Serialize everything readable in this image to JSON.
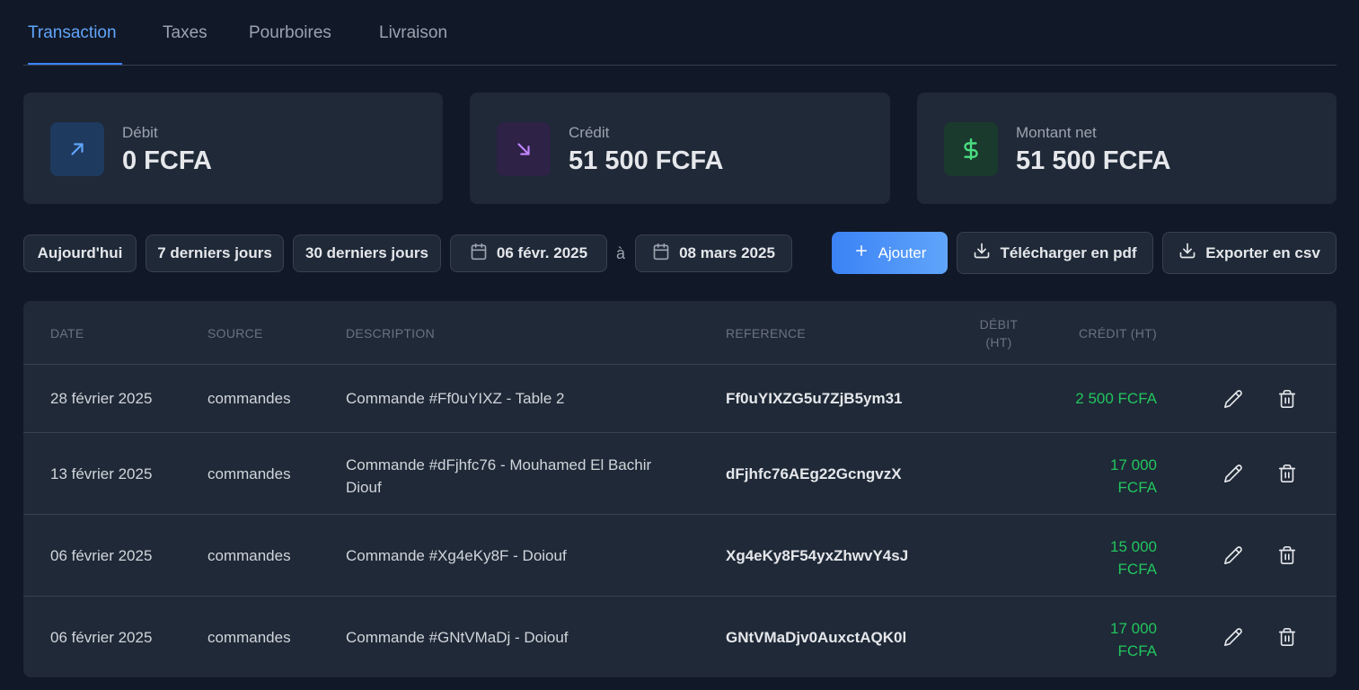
{
  "tabs": [
    "Transaction",
    "Taxes",
    "Pourboires",
    "Livraison"
  ],
  "stats": {
    "debit": {
      "label": "Débit",
      "value": "0 FCFA"
    },
    "credit": {
      "label": "Crédit",
      "value": "51 500 FCFA"
    },
    "net": {
      "label": "Montant net",
      "value": "51 500 FCFA"
    }
  },
  "filters": {
    "today": "Aujourd'hui",
    "last7": "7 derniers jours",
    "last30": "30 derniers jours",
    "date_from": "06 févr. 2025",
    "separator": "à",
    "date_to": "08 mars 2025"
  },
  "actions": {
    "add": "Ajouter",
    "pdf": "Télécharger en pdf",
    "csv": "Exporter en csv"
  },
  "table": {
    "headers": {
      "date": "Date",
      "source": "Source",
      "description": "Description",
      "reference": "Reference",
      "debit_1": "Débit",
      "debit_2": "(HT)",
      "credit": "Crédit (HT)"
    },
    "rows": [
      {
        "date": "28 février 2025",
        "source": "commandes",
        "description": "Commande #Ff0uYIXZ - Table 2",
        "reference": "Ff0uYIXZG5u7ZjB5ym31",
        "credit": "2 500 FCFA"
      },
      {
        "date": "13 février 2025",
        "source": "commandes",
        "description": "Commande #dFjhfc76 - Mouhamed El Bachir Diouf",
        "reference": "dFjhfc76AEg22GcngvzX",
        "credit": "17 000 FCFA"
      },
      {
        "date": "06 février 2025",
        "source": "commandes",
        "description": "Commande #Xg4eKy8F - Doiouf",
        "reference": "Xg4eKy8F54yxZhwvY4sJ",
        "credit": "15 000 FCFA"
      },
      {
        "date": "06 février 2025",
        "source": "commandes",
        "description": "Commande #GNtVMaDj - Doiouf",
        "reference": "GNtVMaDjv0AuxctAQK0l",
        "credit": "17 000 FCFA"
      }
    ]
  },
  "colors": {
    "accent": "#3b82f6",
    "credit": "#22c55e",
    "background": "#111827",
    "card": "#1f2937"
  },
  "icons": [
    "arrow-up-right-icon",
    "arrow-down-right-icon",
    "dollar-icon",
    "calendar-icon",
    "plus-icon",
    "download-icon",
    "pencil-icon",
    "trash-icon"
  ]
}
